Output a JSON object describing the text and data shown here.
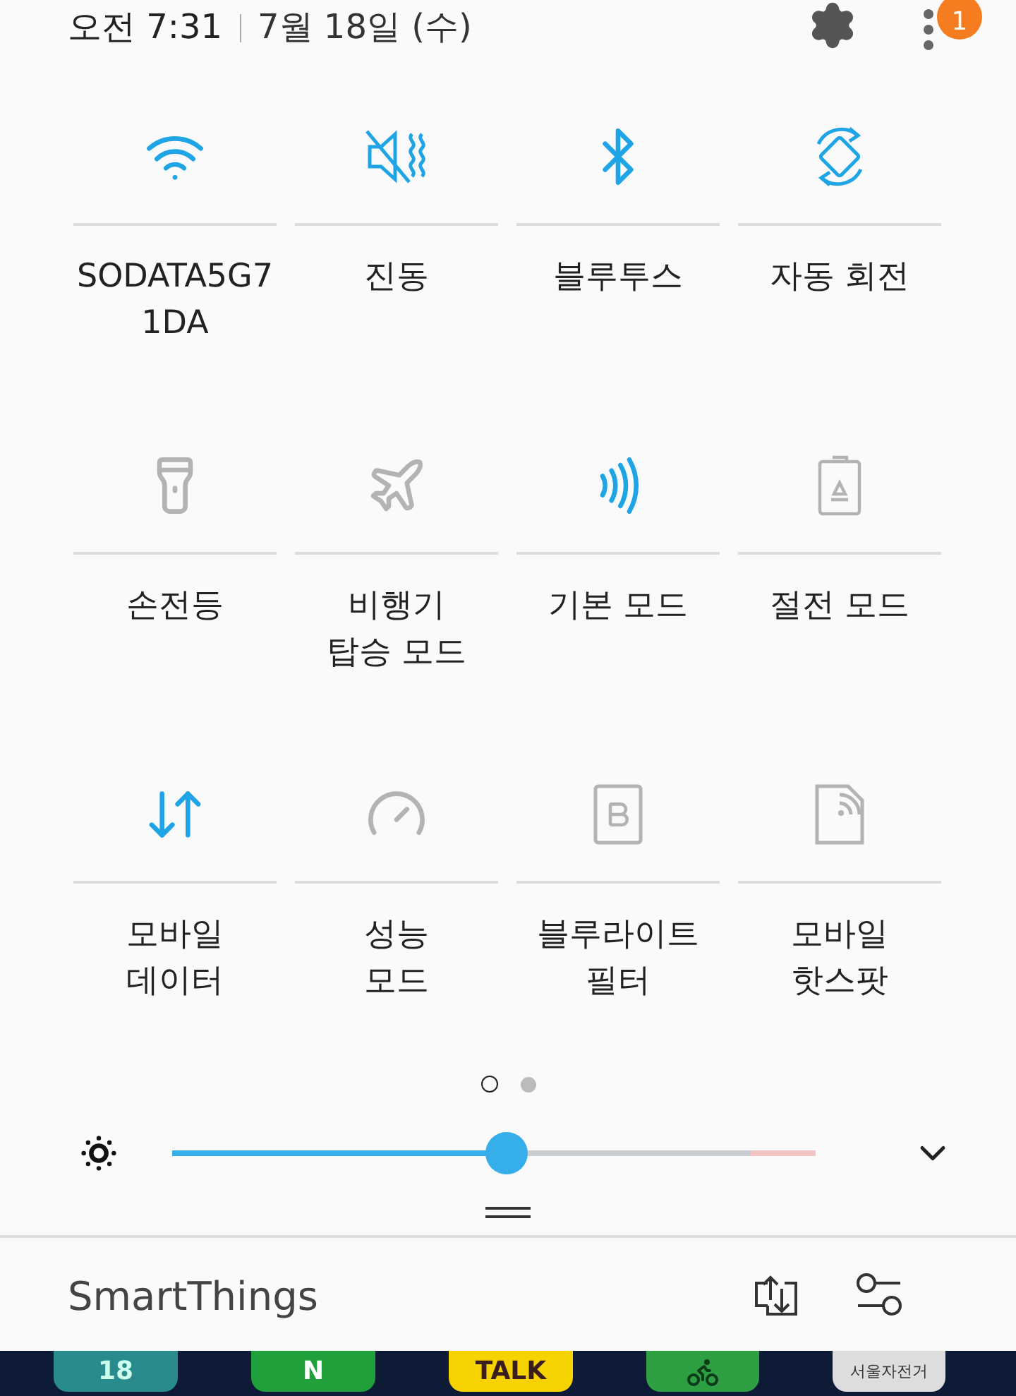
{
  "status_bar": {
    "time": "오전 7:31",
    "date": "7월 18일 (수)",
    "notification_badge": "1"
  },
  "tiles": [
    {
      "kind": "wifi",
      "label": "SODATA5G7\n1DA",
      "on": true
    },
    {
      "kind": "vibrate",
      "label": "진동",
      "on": true
    },
    {
      "kind": "bluetooth",
      "label": "블루투스",
      "on": true
    },
    {
      "kind": "rotate",
      "label": "자동 회전",
      "on": true
    },
    {
      "kind": "flashlight",
      "label": "손전등",
      "on": false
    },
    {
      "kind": "airplane",
      "label": "비행기\n탑승 모드",
      "on": false
    },
    {
      "kind": "nfc",
      "label": "기본 모드",
      "on": true
    },
    {
      "kind": "power_saving",
      "label": "절전 모드",
      "on": false
    },
    {
      "kind": "mobile_data",
      "label": "모바일\n데이터",
      "on": true
    },
    {
      "kind": "performance",
      "label": "성능\n모드",
      "on": false
    },
    {
      "kind": "blue_light",
      "label": "블루라이트\n필터",
      "on": false
    },
    {
      "kind": "hotspot",
      "label": "모바일\n핫스팟",
      "on": false
    }
  ],
  "pages": [
    {
      "selected": true
    },
    {
      "selected": false
    }
  ],
  "brightness": {
    "level": 0.52
  },
  "footer": {
    "title": "SmartThings"
  },
  "home_apps": [
    {
      "kind": "calendar",
      "label": "18"
    },
    {
      "kind": "naver",
      "label": "N"
    },
    {
      "kind": "talk",
      "label": "TALK"
    },
    {
      "kind": "bike"
    },
    {
      "kind": "seoul_bike",
      "label": "서울자전거"
    }
  ]
}
